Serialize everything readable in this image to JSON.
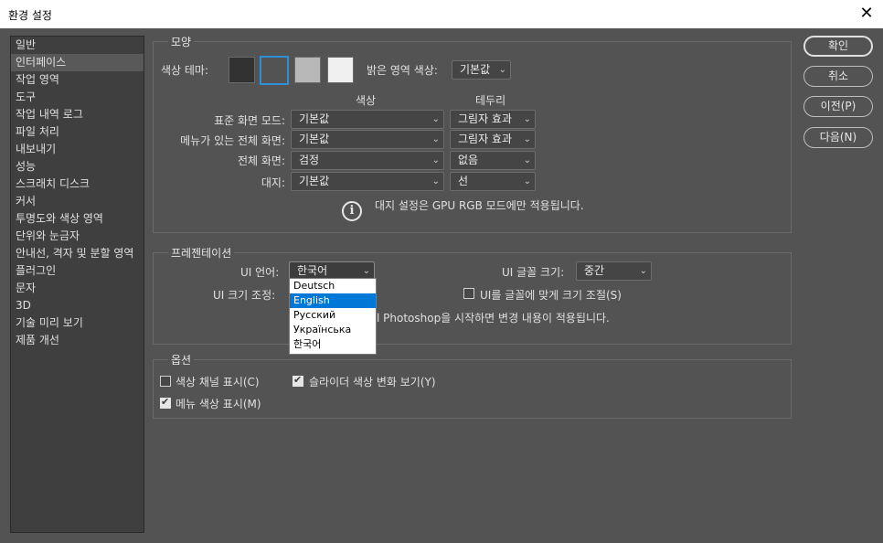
{
  "window": {
    "title": "환경 설정",
    "close_glyph": "✕"
  },
  "sidebar": {
    "items": [
      {
        "label": "일반"
      },
      {
        "label": "인터페이스",
        "active": true
      },
      {
        "label": "작업 영역"
      },
      {
        "label": "도구"
      },
      {
        "label": "작업 내역 로그"
      },
      {
        "label": "파일 처리"
      },
      {
        "label": "내보내기"
      },
      {
        "label": "성능"
      },
      {
        "label": "스크래치 디스크"
      },
      {
        "label": "커서"
      },
      {
        "label": "투명도와 색상 영역"
      },
      {
        "label": "단위와 눈금자"
      },
      {
        "label": "안내선, 격자 및 분할 영역"
      },
      {
        "label": "플러그인"
      },
      {
        "label": "문자"
      },
      {
        "label": "3D"
      },
      {
        "label": "기술 미리 보기"
      },
      {
        "label": "제품 개선"
      }
    ]
  },
  "appearance": {
    "legend": "모양",
    "color_theme_label": "색상 테마:",
    "swatches": [
      "#323232",
      "#535353",
      "#b8b8b8",
      "#f0f0f0"
    ],
    "highlight_label": "밝은 영역 색상:",
    "highlight_value": "기본값",
    "col_color": "색상",
    "col_border": "테두리",
    "rows": [
      {
        "label": "표준 화면 모드:",
        "color": "기본값",
        "border": "그림자 효과"
      },
      {
        "label": "메뉴가 있는 전체 화면:",
        "color": "기본값",
        "border": "그림자 효과"
      },
      {
        "label": "전체 화면:",
        "color": "검정",
        "border": "없음"
      },
      {
        "label": "대지:",
        "color": "기본값",
        "border": "선"
      }
    ],
    "info_text": "대지 설정은 GPU RGB 모드에만 적용됩니다.",
    "info_icon": "i"
  },
  "presentation": {
    "legend": "프레젠테이션",
    "ui_language_label": "UI 언어:",
    "ui_language_value": "한국어",
    "ui_language_options": [
      "Deutsch",
      "English",
      "Русский",
      "Українська",
      "한국어"
    ],
    "ui_language_highlighted": "English",
    "ui_scaling_label": "UI 크기 조정:",
    "ui_font_size_label": "UI 글꼴 크기:",
    "ui_font_size_value": "중간",
    "scale_to_font_label": "UI를 글꼴에 맞게 크기 조절(S)",
    "scale_to_font_checked": false,
    "restart_note_visible": "l Photoshop을 시작하면 변경 내용이 적용됩니다."
  },
  "options": {
    "legend": "옵션",
    "show_channels_label": "색상 채널 표시(C)",
    "show_channels_checked": false,
    "slider_colors_label": "슬라이더 색상 변화 보기(Y)",
    "slider_colors_checked": true,
    "menu_colors_label": "메뉴 색상 표시(M)",
    "menu_colors_checked": true
  },
  "buttons": {
    "ok": "확인",
    "cancel": "취소",
    "prev": "이전(P)",
    "next": "다음(N)"
  },
  "colors": {
    "background": "#535353",
    "panel": "#3f3f3f",
    "accent": "#0078d7",
    "swatch_selected": "#2f8fd7"
  }
}
